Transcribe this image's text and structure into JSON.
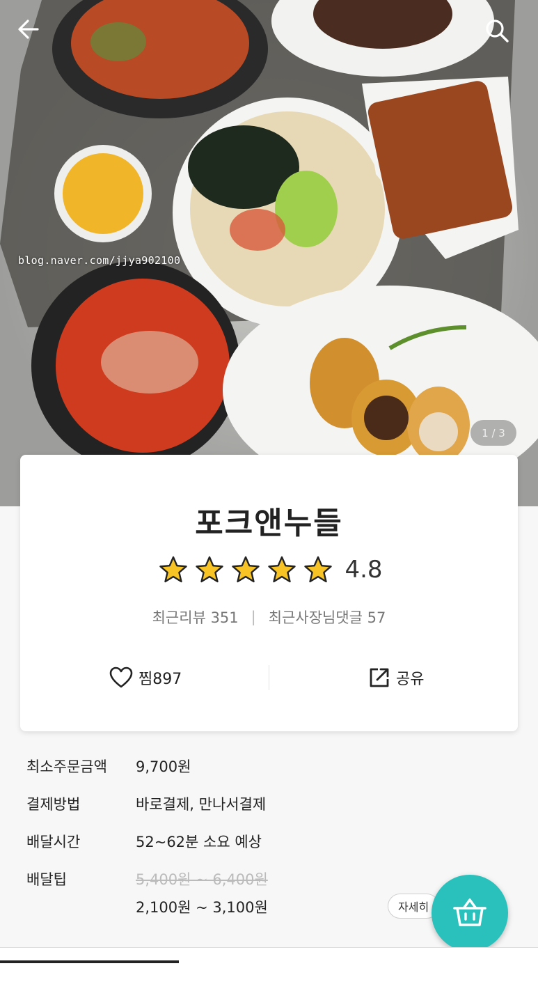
{
  "hero": {
    "watermark": "blog.naver.com/jjya902100",
    "counter": "1 / 3"
  },
  "store": {
    "name": "포크앤누들",
    "rating": "4.8",
    "rating_value": 4.8,
    "star_count": 5,
    "recent_reviews": "최근리뷰 351",
    "owner_replies": "최근사장님댓글 57",
    "like_label": "찜897",
    "share_label": "공유"
  },
  "details": {
    "min_order_label": "최소주문금액",
    "min_order_value": "9,700원",
    "payment_label": "결제방법",
    "payment_value": "바로결제, 만나서결제",
    "delivery_time_label": "배달시간",
    "delivery_time_value": "52~62분 소요 예상",
    "delivery_tip_label": "배달팁",
    "delivery_tip_old": "5,400원 ~ 6,400원",
    "delivery_tip_new": "2,100원 ~ 3,100원",
    "detail_button": "자세히"
  },
  "icons": {
    "back": "arrow-left-icon",
    "search": "search-icon",
    "heart": "heart-icon",
    "share": "share-icon",
    "cart": "basket-icon",
    "star": "star-icon"
  },
  "colors": {
    "accent": "#2ac1bc",
    "star": "#f7c325"
  }
}
